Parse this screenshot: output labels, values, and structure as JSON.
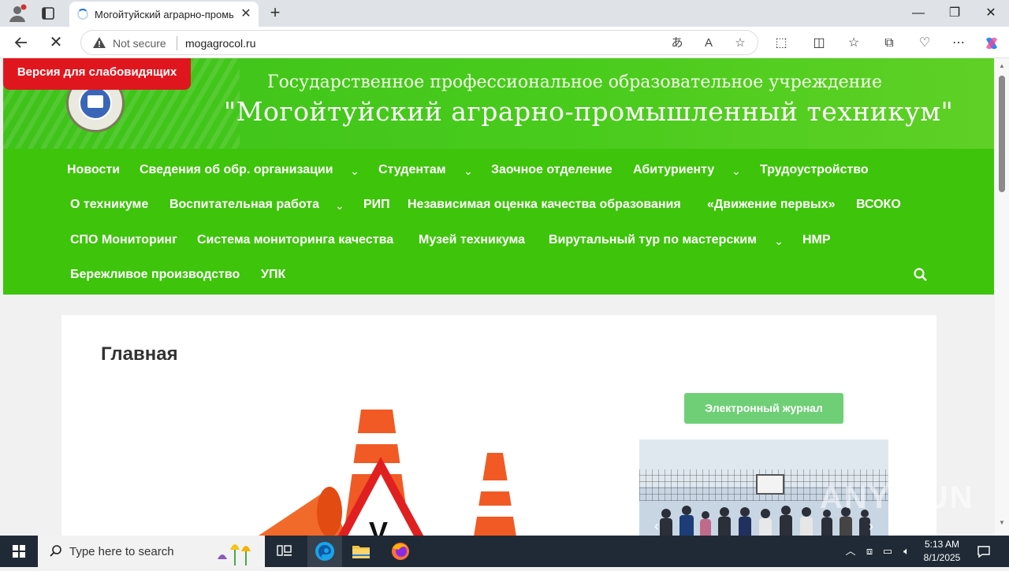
{
  "browser": {
    "tab_title": "Могойтуйский аграрно-промышл",
    "url": "mogagrocol.ru",
    "security_label": "Not secure",
    "window_controls": {
      "minimize": "—",
      "restore": "❐",
      "close": "✕"
    },
    "icons": [
      "profile-icon",
      "tab-actions-icon",
      "back-icon",
      "reload-stop-icon",
      "translate-icon",
      "read-aloud-icon",
      "favorite-star-icon",
      "extensions-icon",
      "split-screen-icon",
      "favorites-icon",
      "collections-icon",
      "browser-essentials-icon",
      "more-menu-icon",
      "copilot-icon"
    ]
  },
  "site": {
    "vision_button": "Версия для слабовидящих",
    "header_line1": "Государственное профессиональное образовательное учреждение",
    "header_line2": "\"Могойтуйский аграрно-промышленный техникум\"",
    "nav_items": [
      "Новости",
      "Сведения об обр. организации",
      "Студентам",
      "Заочное отделение",
      "Абитуриенту",
      "Трудоустройство",
      "О техникуме",
      "Воспитательная работа",
      "РИП",
      "Независимая оценка качества образования",
      "«Движение первых»",
      "ВСОКО",
      "СПО Мониторинг",
      "Система мониторинга качества",
      "Музей техникума",
      "Вирутальный тур по мастерским",
      "НМР",
      "Бережливое производство",
      "УПК"
    ],
    "page_title": "Главная",
    "ej_button": "Электронный журнал",
    "watermark": "ANY RUN",
    "colors": {
      "header_green": "#48cb1c",
      "nav_green": "#3ec40a",
      "vision_red": "#e0161e",
      "ej_green": "#6fcf76"
    }
  },
  "taskbar": {
    "search_placeholder": "Type here to search",
    "time": "5:13 AM",
    "date": "8/1/2025"
  }
}
